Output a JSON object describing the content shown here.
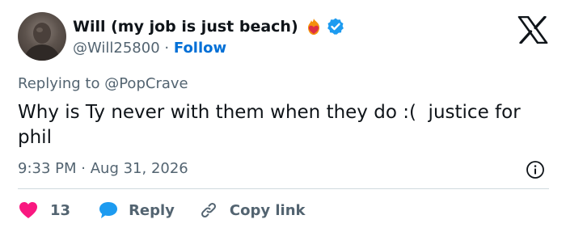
{
  "author": {
    "display_name": "Will (my job is just beach)",
    "handle": "@Will25800",
    "separator": "·",
    "follow_label": "Follow"
  },
  "reply_context": {
    "prefix": "Replying to",
    "mention": "@PopCrave"
  },
  "tweet": {
    "text": "Why is Ty never with them when they do :(  justice for phil",
    "time": "9:33 PM",
    "separator": "·",
    "date": "Aug 31, 2026"
  },
  "actions": {
    "like_count": "13",
    "reply_label": "Reply",
    "copy_label": "Copy link"
  },
  "colors": {
    "like": "#f91880",
    "reply": "#1d9bf0",
    "verified": "#1d9bf0",
    "follow": "#006fd6",
    "muted": "#536471"
  },
  "icons": [
    "fire-heart-emoji-icon",
    "verified-badge-icon",
    "x-logo-icon",
    "info-icon",
    "heart-icon",
    "reply-bubble-icon",
    "link-icon"
  ]
}
